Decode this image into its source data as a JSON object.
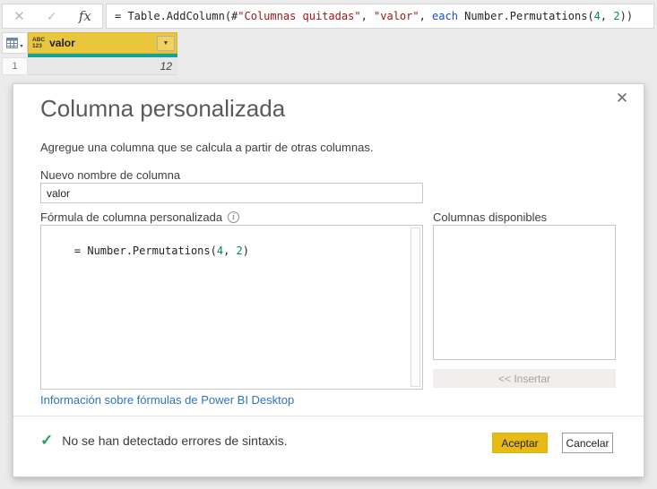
{
  "icons": {
    "cancel_x": "✕",
    "check": "✓",
    "fx": "fx",
    "dropdown": "▼",
    "corner_caret": "▾",
    "info": "i",
    "close": "✕",
    "syntax_ok_check": "✓"
  },
  "formula_bar": {
    "segments": [
      {
        "t": "= Table.AddColumn(#",
        "c": "plain"
      },
      {
        "t": "\"Columnas quitadas\"",
        "c": "string"
      },
      {
        "t": ", ",
        "c": "plain"
      },
      {
        "t": "\"valor\"",
        "c": "string"
      },
      {
        "t": ", ",
        "c": "plain"
      },
      {
        "t": "each",
        "c": "keyword"
      },
      {
        "t": " Number.Permutations(",
        "c": "plain"
      },
      {
        "t": "4",
        "c": "number"
      },
      {
        "t": ", ",
        "c": "plain"
      },
      {
        "t": "2",
        "c": "number"
      },
      {
        "t": "))",
        "c": "plain"
      }
    ]
  },
  "table": {
    "column": {
      "type_icon_line1": "ABC",
      "type_icon_line2": "123",
      "name": "valor"
    },
    "rows": [
      {
        "num": "1",
        "value": "12"
      }
    ]
  },
  "dialog": {
    "title": "Columna personalizada",
    "subtitle": "Agregue una columna que se calcula a partir de otras columnas.",
    "name_label": "Nuevo nombre de columna",
    "name_value": "valor",
    "formula_label": "Fórmula de columna personalizada",
    "formula_segments": [
      {
        "t": "= Number.Permutations(",
        "c": "plain"
      },
      {
        "t": "4",
        "c": "number"
      },
      {
        "t": ", ",
        "c": "plain"
      },
      {
        "t": "2",
        "c": "number"
      },
      {
        "t": ")",
        "c": "plain"
      }
    ],
    "available_columns_label": "Columnas disponibles",
    "available_columns": [],
    "insert_button_label": "<< Insertar",
    "link_label": "Información sobre fórmulas de Power BI Desktop",
    "status_text": "No se han detectado errores de sintaxis.",
    "ok_button_label": "Aceptar",
    "cancel_button_label": "Cancelar"
  },
  "colors": {
    "header_yellow": "#eac63c",
    "accent_yellow_button": "#e8ba16",
    "teal_selection": "#12a296",
    "link_blue": "#2e75b6",
    "check_green": "#21a463",
    "syntax_string": "#a31515",
    "syntax_keyword": "#1b49c8",
    "syntax_number": "#0a8658"
  }
}
